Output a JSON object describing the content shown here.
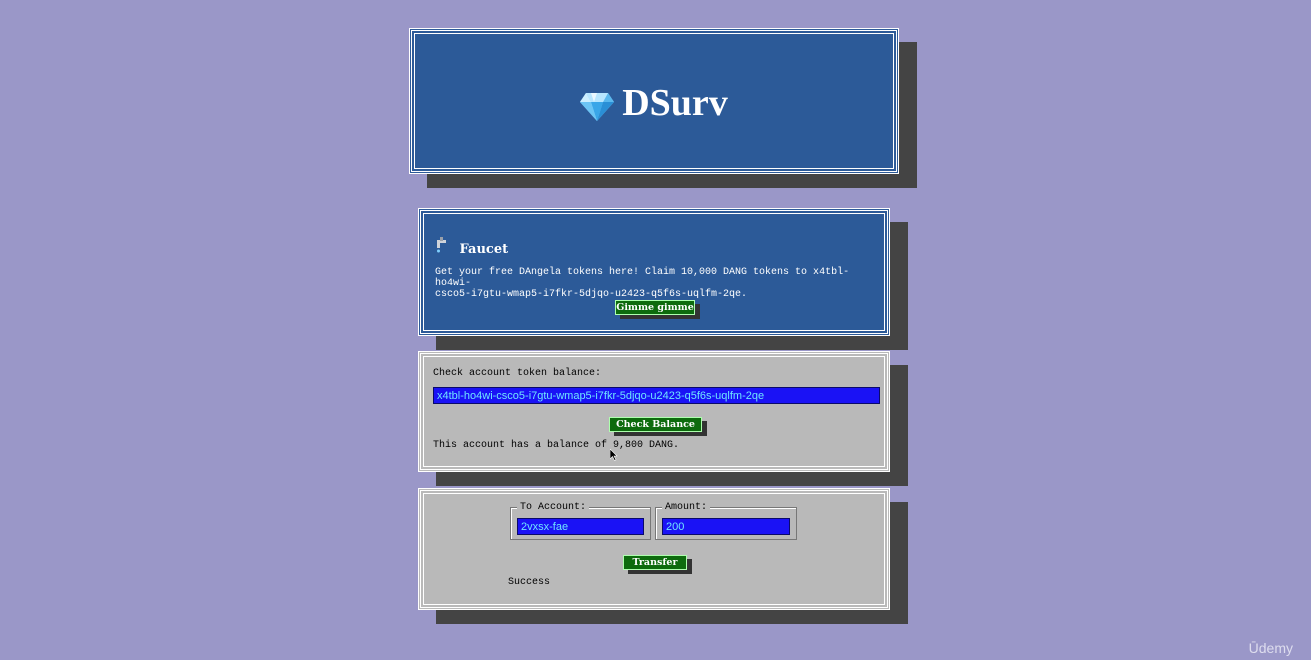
{
  "header": {
    "logo_icon": "diamond-icon",
    "app_title": "DSurv"
  },
  "faucet": {
    "icon": "faucet-icon",
    "title": "Faucet",
    "description_line1": "Get your free DAngela tokens here! Claim 10,000 DANG tokens to x4tbl-ho4wi-",
    "description_line2": "csco5-i7gtu-wmap5-i7fkr-5djqo-u2423-q5f6s-uqlfm-2qe.",
    "button_label": "Gimme gimme"
  },
  "balance": {
    "label": "Check account token balance:",
    "input_value": "x4tbl-ho4wi-csco5-i7gtu-wmap5-i7fkr-5djqo-u2423-q5f6s-uqlfm-2qe",
    "button_label": "Check Balance",
    "result_text": "This account has a balance of 9,800 DANG."
  },
  "transfer": {
    "to_account_label": "To Account:",
    "to_account_value": "2vxsx-fae",
    "amount_label": "Amount:",
    "amount_value": "200",
    "button_label": "Transfer",
    "status_text": "Success"
  },
  "watermark": "Ūdemy",
  "colors": {
    "background": "#9a97c8",
    "panel_blue": "#2c5a98",
    "panel_grey": "#b9b9b9",
    "button_green": "#0d6b0d",
    "input_blue": "#1a12f5"
  }
}
